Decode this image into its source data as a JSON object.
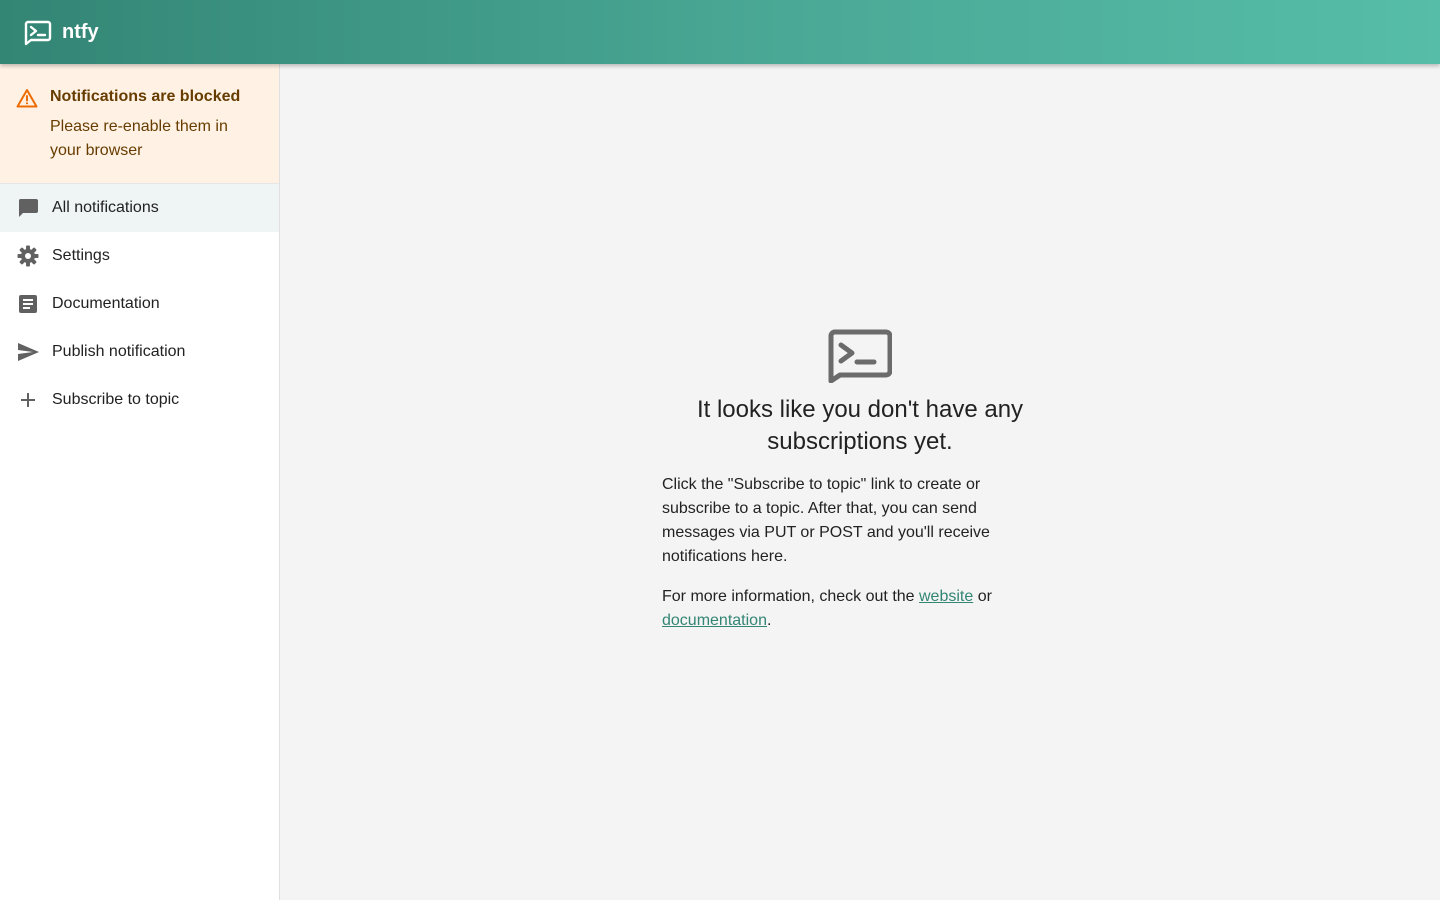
{
  "app": {
    "title": "ntfy"
  },
  "alert": {
    "title": "Notifications are blocked",
    "text": "Please re-enable them in your browser",
    "icon": "warning-icon",
    "color": "#663c00",
    "background": "#fff2e5"
  },
  "sidebar": {
    "items": [
      {
        "label": "All notifications",
        "icon": "chat-icon",
        "selected": true
      },
      {
        "label": "Settings",
        "icon": "gear-icon",
        "selected": false
      },
      {
        "label": "Documentation",
        "icon": "document-icon",
        "selected": false
      },
      {
        "label": "Publish notification",
        "icon": "send-icon",
        "selected": false
      },
      {
        "label": "Subscribe to topic",
        "icon": "plus-icon",
        "selected": false
      }
    ]
  },
  "main": {
    "empty_icon": "ntfy-logo-icon",
    "title": "It looks like you don't have any subscriptions yet.",
    "description": "Click the \"Subscribe to topic\" link to create or subscribe to a topic. After that, you can send messages via PUT or POST and you'll receive notifications here.",
    "more_prefix": "For more information, check out the ",
    "website_link": "website",
    "more_middle": " or ",
    "docs_link": "documentation",
    "more_suffix": "."
  },
  "colors": {
    "header_start": "#338574",
    "header_end": "#56bda8",
    "link": "#338574",
    "selected_bg": "#eef5f4"
  }
}
